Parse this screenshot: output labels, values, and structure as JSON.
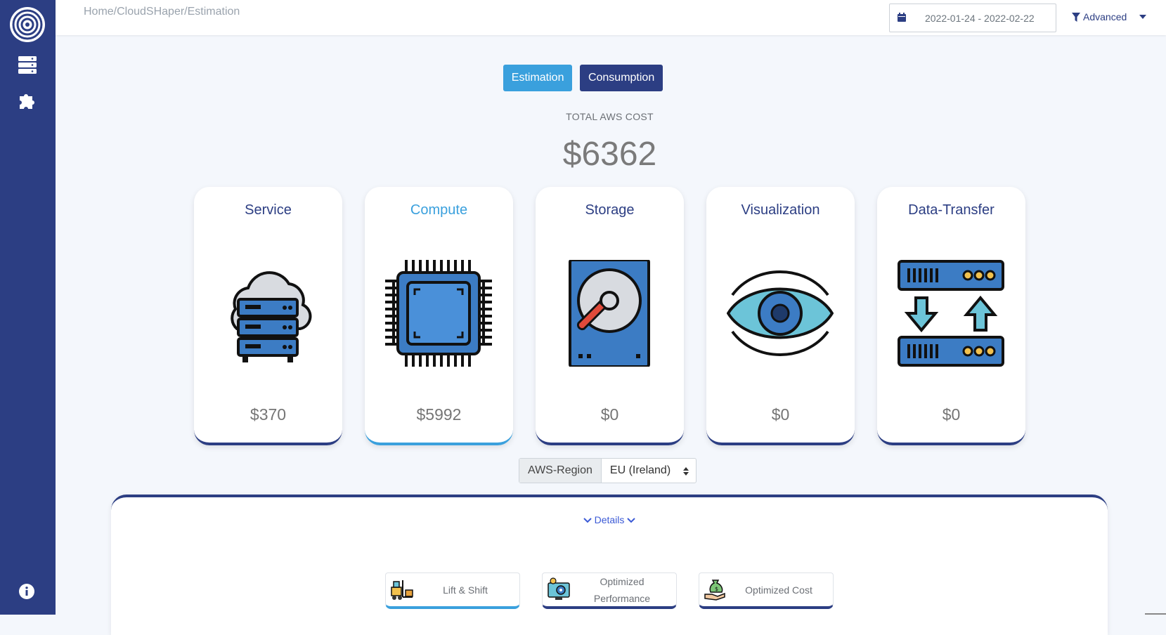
{
  "breadcrumb": "Home/CloudSHaper/Estimation",
  "date_range": "2022-01-24 - 2022-02-22",
  "advanced_label": "Advanced",
  "tabs": {
    "estimation": "Estimation",
    "consumption": "Consumption"
  },
  "total": {
    "label": "TOTAL AWS COST",
    "value": "$6362"
  },
  "cards": [
    {
      "title": "Service",
      "value": "$370",
      "icon": "cloud-server-icon"
    },
    {
      "title": "Compute",
      "value": "$5992",
      "icon": "cpu-chip-icon"
    },
    {
      "title": "Storage",
      "value": "$0",
      "icon": "hard-drive-icon"
    },
    {
      "title": "Visualization",
      "value": "$0",
      "icon": "eye-icon"
    },
    {
      "title": "Data-Transfer",
      "value": "$0",
      "icon": "data-transfer-icon"
    }
  ],
  "region": {
    "label": "AWS-Region",
    "selected": "EU (Ireland)"
  },
  "details_label": "Details",
  "options": [
    {
      "label": "Lift & Shift",
      "icon": "forklift-icon"
    },
    {
      "label": "Optimized Performance",
      "icon": "monitor-gear-icon"
    },
    {
      "label": "Optimized Cost",
      "icon": "money-bag-hand-icon"
    }
  ],
  "colors": {
    "sidebar": "#2c3e83",
    "accent": "#3aa0dd",
    "background": "#f4f7fc"
  }
}
